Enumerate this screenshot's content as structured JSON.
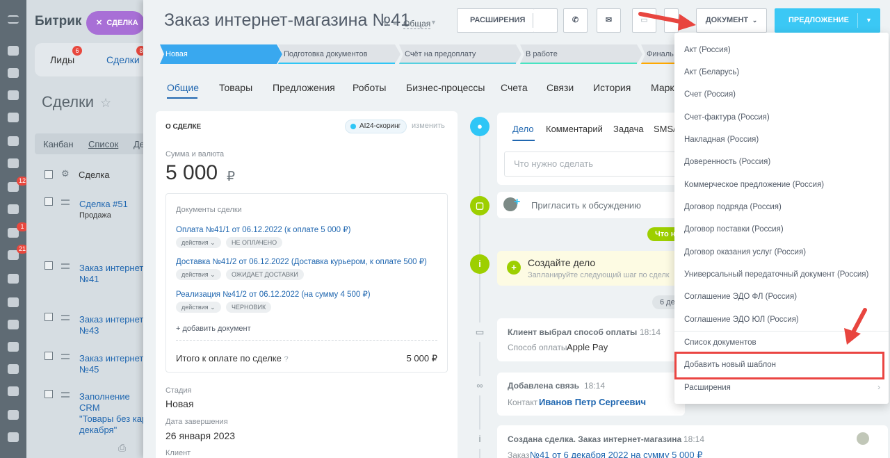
{
  "background": {
    "logo": "Битрик",
    "pill": "СДЕЛКА",
    "tabs": [
      {
        "label": "Лиды",
        "badge": "6"
      },
      {
        "label": "Сделки",
        "badge": "8"
      }
    ],
    "heading": "Сделки",
    "views": [
      "Канбан",
      "Список",
      "Де"
    ],
    "column": "Сделка",
    "rows": [
      {
        "title": "Сделка #51",
        "sub": "Продажа"
      },
      {
        "title": "Заказ интернет-\n№41",
        "sub": ""
      },
      {
        "title": "Заказ интернет-\n№43",
        "sub": ""
      },
      {
        "title": "Заказ интернет-\n№45",
        "sub": ""
      },
      {
        "title": "Заполнение CRM\n\"Товары без кар\nдекабря\"",
        "sub": ""
      }
    ],
    "rail_badges": [
      "12",
      "1",
      "21"
    ]
  },
  "header": {
    "title": "Заказ интернет-магазина №41",
    "category": "Общая",
    "extensions_label": "РАСШИРЕНИЯ",
    "document_label": "ДОКУМЕНТ",
    "proposal_label": "ПРЕДЛОЖЕНИЕ"
  },
  "stages": [
    {
      "label": "Новая",
      "color": "#39a8ef"
    },
    {
      "label": "Подготовка документов",
      "color": "#2fc6f6"
    },
    {
      "label": "Счёт на предоплату",
      "color": "#55d0e0"
    },
    {
      "label": "В работе",
      "color": "#47e4c2"
    },
    {
      "label": "Финаль",
      "color": "#ffa900"
    }
  ],
  "tabs": [
    "Общие",
    "Товары",
    "Предложения",
    "Роботы",
    "Бизнес-процессы",
    "Счета",
    "Связи",
    "История",
    "Марк"
  ],
  "deal": {
    "section_title": "О СДЕЛКЕ",
    "ai_badge": "AI24-скоринг",
    "edit": "изменить",
    "amount_label": "Сумма и валюта",
    "amount": "5 000",
    "currency": "₽",
    "docs_label": "Документы сделки",
    "documents": [
      {
        "title": "Оплата №41/1 от 06.12.2022 (к оплате 5 000 ₽)",
        "actions": "действия",
        "status": "НЕ ОПЛАЧЕНО"
      },
      {
        "title": "Доставка №41/2 от 06.12.2022 (Доставка курьером, к оплате 500 ₽)",
        "actions": "действия",
        "status": "ОЖИДАЕТ ДОСТАВКИ"
      },
      {
        "title": "Реализация №41/2 от 06.12.2022 (на сумму 4 500 ₽)",
        "actions": "действия",
        "status": "ЧЕРНОВИК"
      }
    ],
    "add_document": "+ добавить документ",
    "total_label": "Итого к оплате по сделке",
    "total_value": "5 000 ₽",
    "stage_label": "Стадия",
    "stage_value": "Новая",
    "close_date_label": "Дата завершения",
    "close_date_value": "26 января 2023",
    "client_label": "Клиент"
  },
  "timeline": {
    "tabs": [
      "Дело",
      "Комментарий",
      "Задача",
      "SMS/"
    ],
    "input_placeholder": "Что нужно сделать",
    "invite": "Пригласить к обсуждению",
    "pill_green": "Что н",
    "create_title": "Создайте дело",
    "create_sub": "Запланируйте следующий шаг по сделк",
    "pill_gray": "6 де",
    "events": [
      {
        "title": "Клиент выбрал способ оплаты",
        "time": "18:14",
        "body_prefix": "Способ оплаты",
        "body_value": "Apple Pay"
      },
      {
        "title": "Добавлена связь",
        "time": "18:14",
        "body_prefix": "Контакт",
        "body_value": "Иванов Петр Сергеевич"
      },
      {
        "title": "Создана сделка. Заказ интернет-магазина",
        "time": "18:14",
        "body_prefix": "Заказ",
        "body_value": "№41 от 6 декабря 2022 на сумму 5 000 ₽"
      }
    ]
  },
  "document_menu": {
    "items": [
      "Акт (Россия)",
      "Акт (Беларусь)",
      "Счет (Россия)",
      "Счет-фактура (Россия)",
      "Накладная (Россия)",
      "Доверенность (Россия)",
      "Коммерческое предложение (Россия)",
      "Договор подряда (Россия)",
      "Договор поставки (Россия)",
      "Договор оказания услуг (Россия)",
      "Универсальный передаточный документ (Россия)",
      "Соглашение ЭДО ФЛ (Россия)",
      "Соглашение ЭДО ЮЛ (Россия)"
    ],
    "list_documents": "Список документов",
    "add_template": "Добавить новый шаблон",
    "extensions": "Расширения"
  }
}
